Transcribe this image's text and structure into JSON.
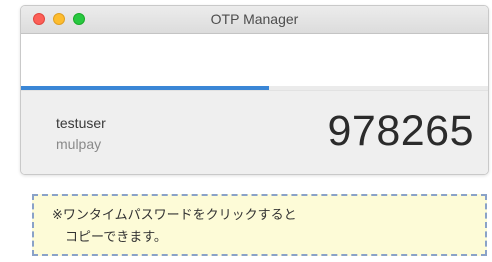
{
  "window": {
    "title": "OTP Manager"
  },
  "progress": {
    "value_fraction": 0.53,
    "color": "#3a86d6"
  },
  "account": {
    "name": "testuser",
    "issuer": "mulpay",
    "code": "978265"
  },
  "note": {
    "line1": "※ワンタイムパスワードをクリックすると",
    "line2": "コピーできます。"
  },
  "colors": {
    "close": "#fc5f57",
    "minimize": "#fdbc2e",
    "maximize": "#28c840",
    "note_background": "#fdfbd7",
    "note_border": "#8aa2c8"
  }
}
